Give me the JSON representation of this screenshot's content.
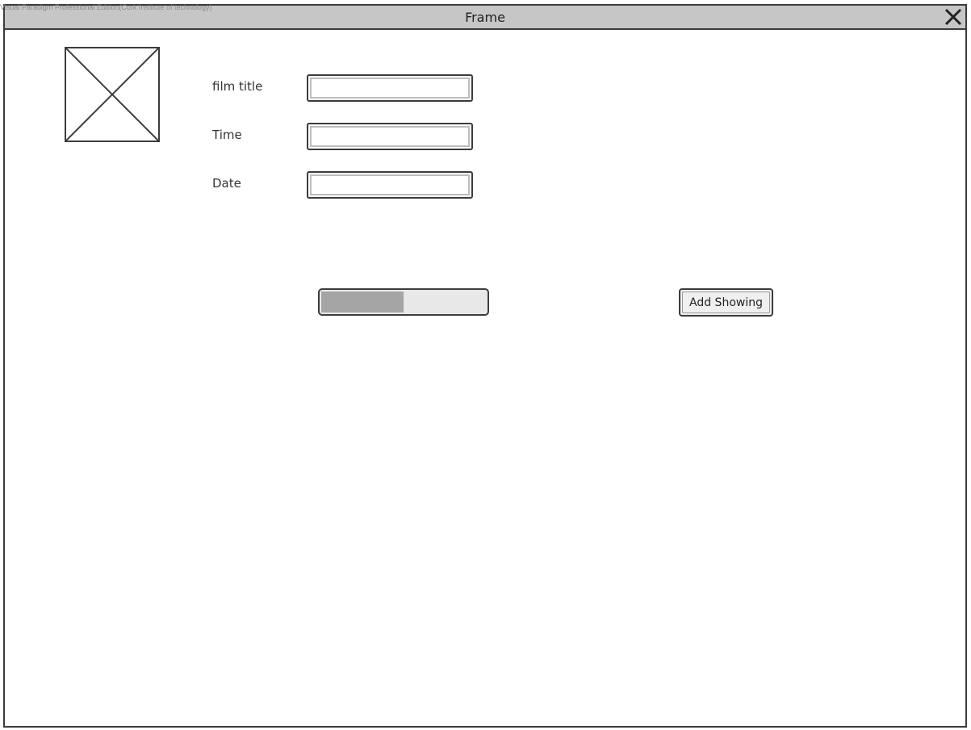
{
  "watermark": "Visual Paradigm Professional Edition(Cork Institute of technology)",
  "window": {
    "title": "Frame",
    "close_icon": "close-icon"
  },
  "image_placeholder": {
    "icon": "image-placeholder-icon"
  },
  "form": {
    "fields": [
      {
        "label": "film title",
        "value": "",
        "placeholder": ""
      },
      {
        "label": "Time",
        "value": "",
        "placeholder": ""
      },
      {
        "label": "Date",
        "value": "",
        "placeholder": ""
      }
    ]
  },
  "progress": {
    "fraction": 0.5
  },
  "actions": {
    "add_showing_label": "Add Showing"
  },
  "colors": {
    "titlebar": "#c6c6c6",
    "border": "#3c3c3c",
    "progress_fill": "#a5a5a5",
    "progress_track": "#e8e8e8"
  }
}
